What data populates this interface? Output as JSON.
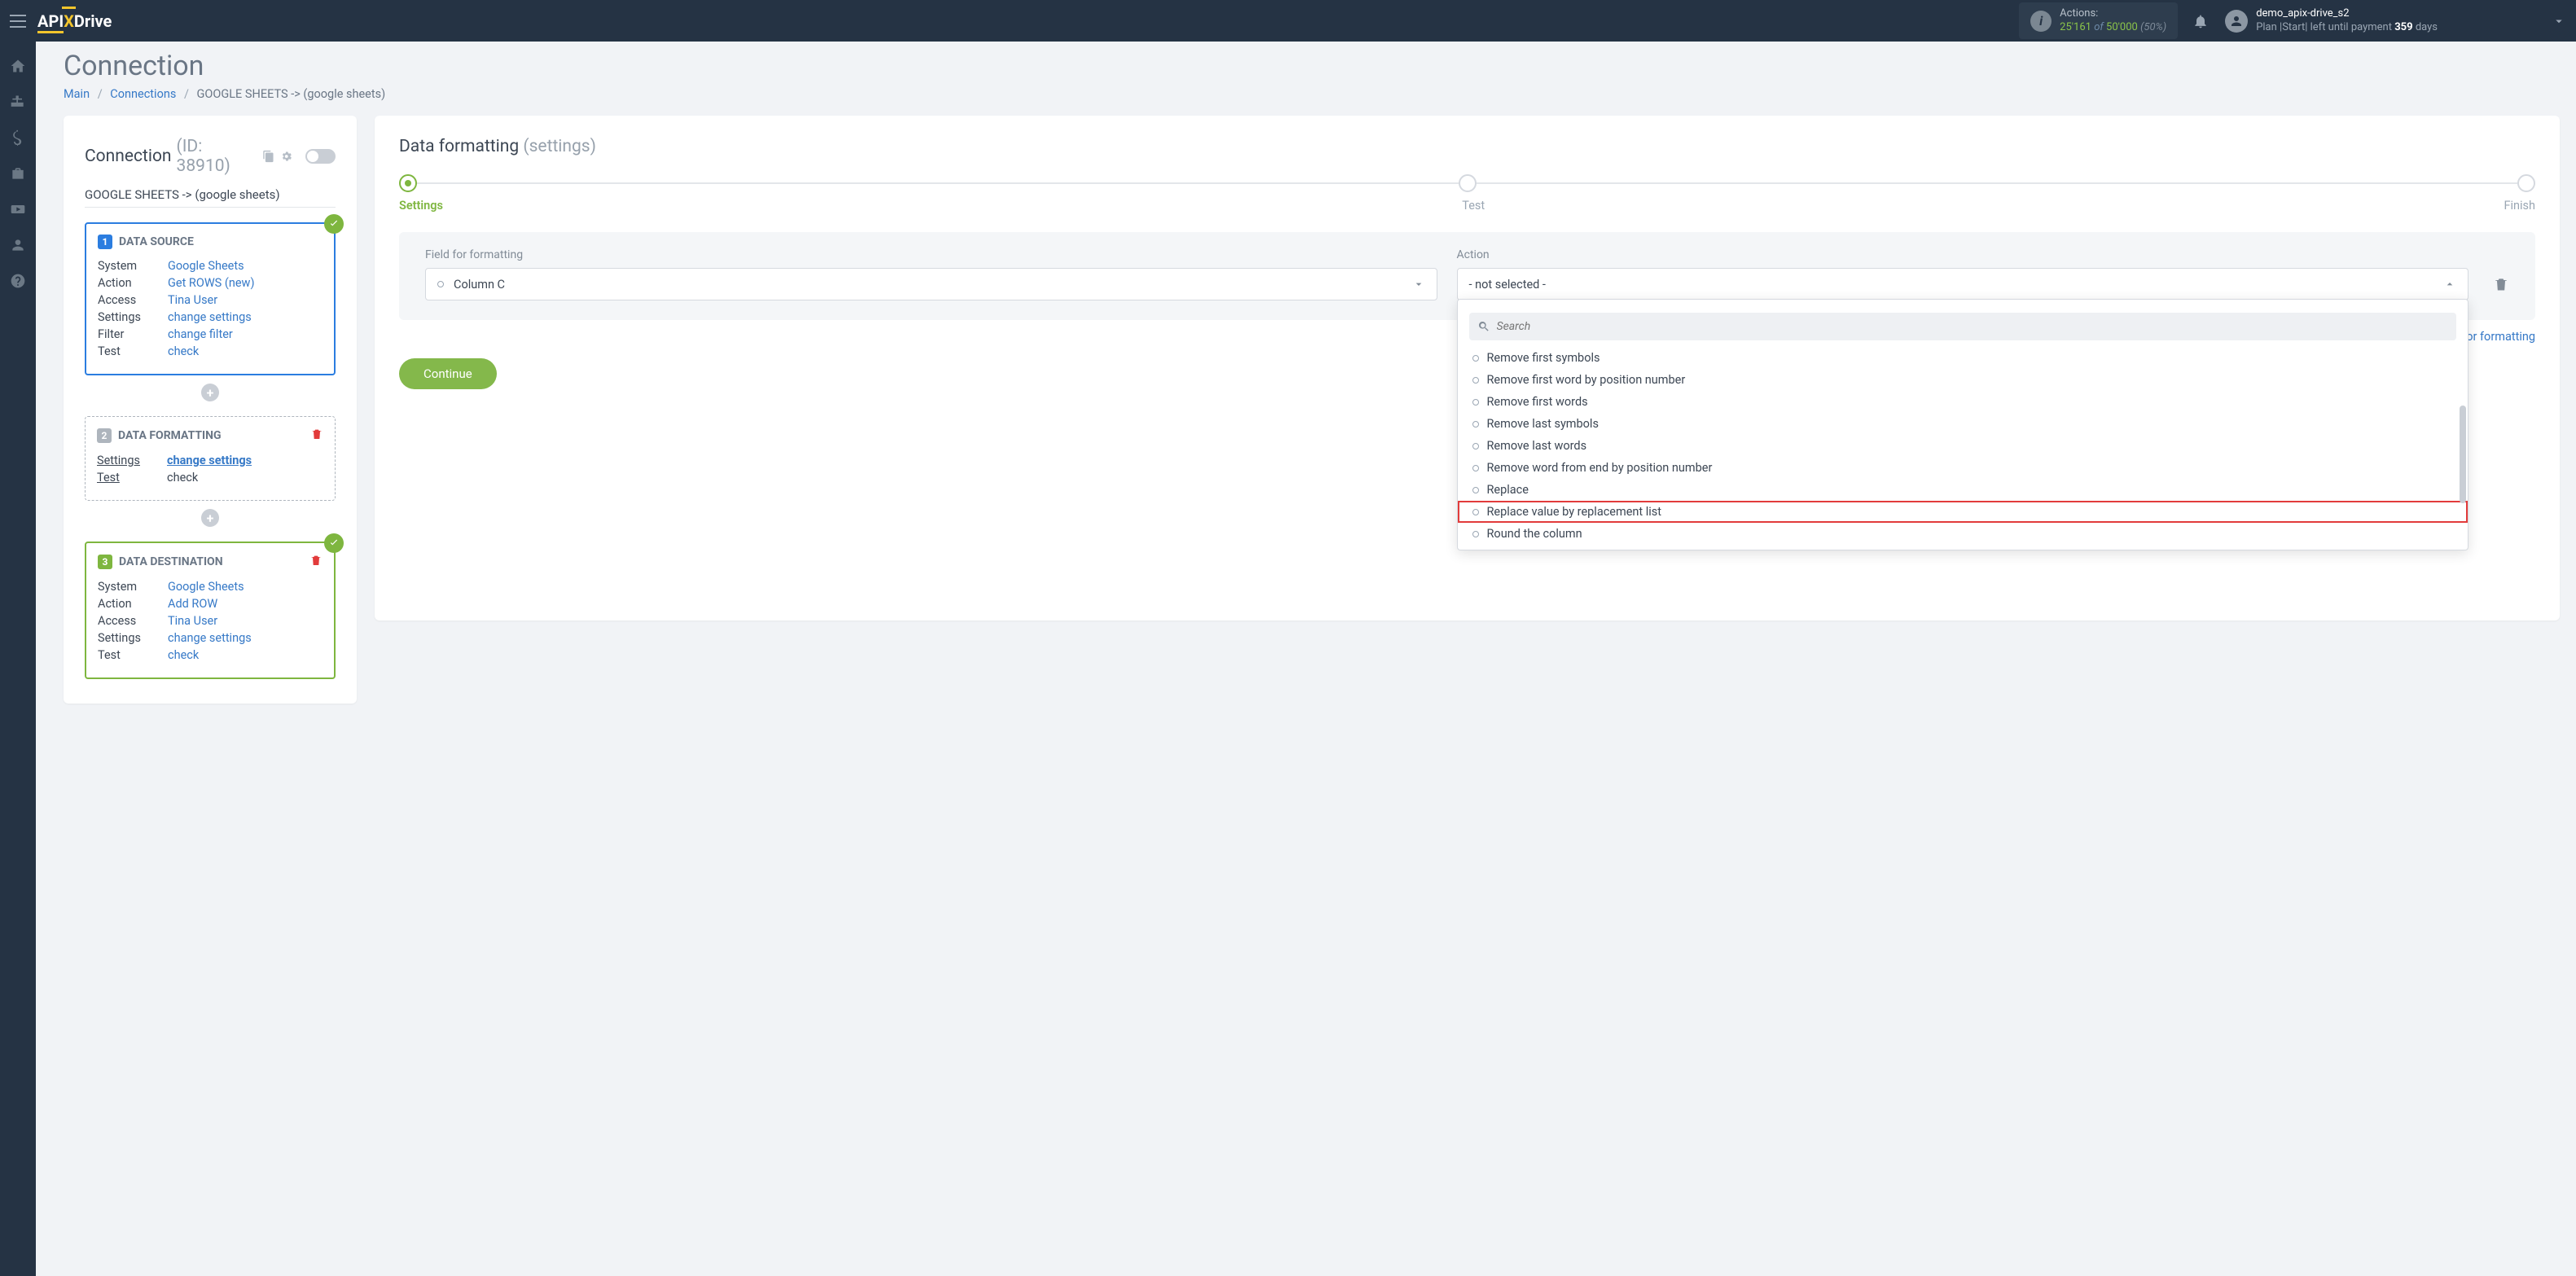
{
  "topbar": {
    "logo": {
      "api": "API",
      "x": "X",
      "drive": "Drive"
    },
    "actions": {
      "label": "Actions:",
      "used": "25'161",
      "of": "of",
      "total": "50'000",
      "pct": "(50%)"
    },
    "user": {
      "name": "demo_apix-drive_s2",
      "plan_prefix": "Plan |Start| left until payment ",
      "days": "359",
      "days_suffix": " days"
    }
  },
  "page": {
    "title": "Connection",
    "breadcrumb": {
      "main": "Main",
      "connections": "Connections",
      "current": "GOOGLE SHEETS -> (google sheets)"
    }
  },
  "left": {
    "title": "Connection",
    "id_label": "(ID: 38910)",
    "subtitle": "GOOGLE SHEETS -> (google sheets)",
    "steps": [
      {
        "num": "1",
        "title": "DATA SOURCE",
        "color": "blue",
        "checked": true,
        "delete": false,
        "rows": [
          {
            "label": "System",
            "value": "Google Sheets",
            "link": true
          },
          {
            "label": "Action",
            "value": "Get ROWS (new)",
            "link": true
          },
          {
            "label": "Access",
            "value": "Tina User",
            "link": true
          },
          {
            "label": "Settings",
            "value": "change settings",
            "link": true
          },
          {
            "label": "Filter",
            "value": "change filter",
            "link": true
          },
          {
            "label": "Test",
            "value": "check",
            "link": true
          }
        ]
      },
      {
        "num": "2",
        "title": "DATA FORMATTING",
        "color": "dashed",
        "checked": false,
        "delete": true,
        "rows": [
          {
            "label": "Settings",
            "value": "change settings",
            "link": true,
            "bold": true,
            "underline_label": true
          },
          {
            "label": "Test",
            "value": "check",
            "link": false
          }
        ]
      },
      {
        "num": "3",
        "title": "DATA DESTINATION",
        "color": "green",
        "checked": true,
        "delete": true,
        "rows": [
          {
            "label": "System",
            "value": "Google Sheets",
            "link": true
          },
          {
            "label": "Action",
            "value": "Add ROW",
            "link": true
          },
          {
            "label": "Access",
            "value": "Tina User",
            "link": true
          },
          {
            "label": "Settings",
            "value": "change settings",
            "link": true
          },
          {
            "label": "Test",
            "value": "check",
            "link": true
          }
        ]
      }
    ]
  },
  "right": {
    "title": "Data formatting",
    "subtitle": "(settings)",
    "stepper": [
      "Settings",
      "Test",
      "Finish"
    ],
    "active_step": 0,
    "field_label": "Field for formatting",
    "field_value": "Column C",
    "action_label": "Action",
    "action_value": "- not selected -",
    "add_link": "+ Add one more field for formatting",
    "continue": "Continue",
    "dropdown": {
      "search_placeholder": "Search",
      "options": [
        "Remove first symbols",
        "Remove first word by position number",
        "Remove first words",
        "Remove last symbols",
        "Remove last words",
        "Remove word from end by position number",
        "Replace",
        "Replace value by replacement list",
        "Round the column"
      ],
      "highlight_index": 7
    }
  }
}
